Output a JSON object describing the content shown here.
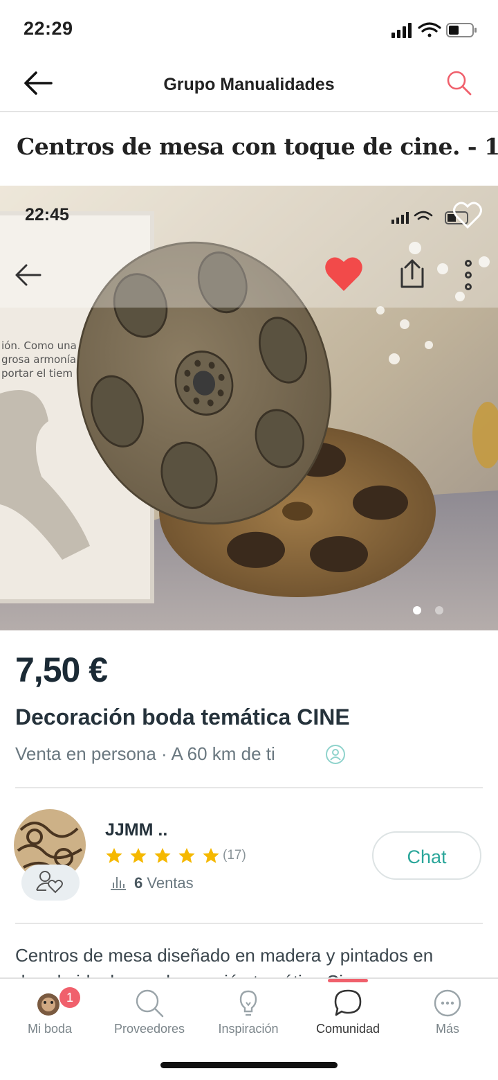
{
  "status_bar": {
    "time": "22:29"
  },
  "header": {
    "title": "Grupo Manualidades"
  },
  "post": {
    "title": "Centros de mesa con toque de cine. - 1"
  },
  "photo": {
    "inner_time": "22:45"
  },
  "listing": {
    "price": "7,50 €",
    "title": "Decoración boda temática CINE",
    "location": "Venta en persona · A 60 km de ti"
  },
  "seller": {
    "name": "JJMM ..",
    "rating_stars": 5,
    "review_count": "(17)",
    "sales_count": "6",
    "sales_label": "Ventas",
    "chat_label": "Chat"
  },
  "description": {
    "text": "Centros de mesa diseñado en madera y pintados en dorado ideal para decoración temática Cine"
  },
  "tabbar": {
    "active": "Comunidad",
    "badge": "1",
    "tabs": [
      {
        "label": "Mi boda"
      },
      {
        "label": "Proveedores"
      },
      {
        "label": "Inspiración"
      },
      {
        "label": "Comunidad"
      },
      {
        "label": "Más"
      }
    ]
  },
  "colors": {
    "accent_red": "#f0606c",
    "teal": "#2aa69a",
    "heart_red": "#f24a4a",
    "star": "#f5b800"
  }
}
